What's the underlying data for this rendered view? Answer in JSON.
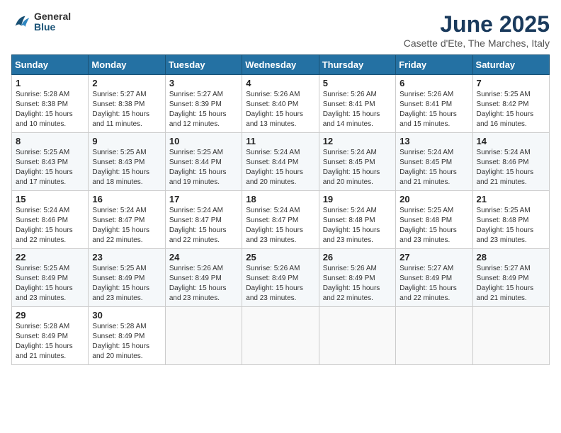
{
  "logo": {
    "general": "General",
    "blue": "Blue"
  },
  "title": "June 2025",
  "subtitle": "Casette d'Ete, The Marches, Italy",
  "days_of_week": [
    "Sunday",
    "Monday",
    "Tuesday",
    "Wednesday",
    "Thursday",
    "Friday",
    "Saturday"
  ],
  "weeks": [
    [
      {
        "day": "1",
        "sunrise": "5:28 AM",
        "sunset": "8:38 PM",
        "daylight": "15 hours and 10 minutes."
      },
      {
        "day": "2",
        "sunrise": "5:27 AM",
        "sunset": "8:38 PM",
        "daylight": "15 hours and 11 minutes."
      },
      {
        "day": "3",
        "sunrise": "5:27 AM",
        "sunset": "8:39 PM",
        "daylight": "15 hours and 12 minutes."
      },
      {
        "day": "4",
        "sunrise": "5:26 AM",
        "sunset": "8:40 PM",
        "daylight": "15 hours and 13 minutes."
      },
      {
        "day": "5",
        "sunrise": "5:26 AM",
        "sunset": "8:41 PM",
        "daylight": "15 hours and 14 minutes."
      },
      {
        "day": "6",
        "sunrise": "5:26 AM",
        "sunset": "8:41 PM",
        "daylight": "15 hours and 15 minutes."
      },
      {
        "day": "7",
        "sunrise": "5:25 AM",
        "sunset": "8:42 PM",
        "daylight": "15 hours and 16 minutes."
      }
    ],
    [
      {
        "day": "8",
        "sunrise": "5:25 AM",
        "sunset": "8:43 PM",
        "daylight": "15 hours and 17 minutes."
      },
      {
        "day": "9",
        "sunrise": "5:25 AM",
        "sunset": "8:43 PM",
        "daylight": "15 hours and 18 minutes."
      },
      {
        "day": "10",
        "sunrise": "5:25 AM",
        "sunset": "8:44 PM",
        "daylight": "15 hours and 19 minutes."
      },
      {
        "day": "11",
        "sunrise": "5:24 AM",
        "sunset": "8:44 PM",
        "daylight": "15 hours and 20 minutes."
      },
      {
        "day": "12",
        "sunrise": "5:24 AM",
        "sunset": "8:45 PM",
        "daylight": "15 hours and 20 minutes."
      },
      {
        "day": "13",
        "sunrise": "5:24 AM",
        "sunset": "8:45 PM",
        "daylight": "15 hours and 21 minutes."
      },
      {
        "day": "14",
        "sunrise": "5:24 AM",
        "sunset": "8:46 PM",
        "daylight": "15 hours and 21 minutes."
      }
    ],
    [
      {
        "day": "15",
        "sunrise": "5:24 AM",
        "sunset": "8:46 PM",
        "daylight": "15 hours and 22 minutes."
      },
      {
        "day": "16",
        "sunrise": "5:24 AM",
        "sunset": "8:47 PM",
        "daylight": "15 hours and 22 minutes."
      },
      {
        "day": "17",
        "sunrise": "5:24 AM",
        "sunset": "8:47 PM",
        "daylight": "15 hours and 22 minutes."
      },
      {
        "day": "18",
        "sunrise": "5:24 AM",
        "sunset": "8:47 PM",
        "daylight": "15 hours and 23 minutes."
      },
      {
        "day": "19",
        "sunrise": "5:24 AM",
        "sunset": "8:48 PM",
        "daylight": "15 hours and 23 minutes."
      },
      {
        "day": "20",
        "sunrise": "5:25 AM",
        "sunset": "8:48 PM",
        "daylight": "15 hours and 23 minutes."
      },
      {
        "day": "21",
        "sunrise": "5:25 AM",
        "sunset": "8:48 PM",
        "daylight": "15 hours and 23 minutes."
      }
    ],
    [
      {
        "day": "22",
        "sunrise": "5:25 AM",
        "sunset": "8:49 PM",
        "daylight": "15 hours and 23 minutes."
      },
      {
        "day": "23",
        "sunrise": "5:25 AM",
        "sunset": "8:49 PM",
        "daylight": "15 hours and 23 minutes."
      },
      {
        "day": "24",
        "sunrise": "5:26 AM",
        "sunset": "8:49 PM",
        "daylight": "15 hours and 23 minutes."
      },
      {
        "day": "25",
        "sunrise": "5:26 AM",
        "sunset": "8:49 PM",
        "daylight": "15 hours and 23 minutes."
      },
      {
        "day": "26",
        "sunrise": "5:26 AM",
        "sunset": "8:49 PM",
        "daylight": "15 hours and 22 minutes."
      },
      {
        "day": "27",
        "sunrise": "5:27 AM",
        "sunset": "8:49 PM",
        "daylight": "15 hours and 22 minutes."
      },
      {
        "day": "28",
        "sunrise": "5:27 AM",
        "sunset": "8:49 PM",
        "daylight": "15 hours and 21 minutes."
      }
    ],
    [
      {
        "day": "29",
        "sunrise": "5:28 AM",
        "sunset": "8:49 PM",
        "daylight": "15 hours and 21 minutes."
      },
      {
        "day": "30",
        "sunrise": "5:28 AM",
        "sunset": "8:49 PM",
        "daylight": "15 hours and 20 minutes."
      },
      null,
      null,
      null,
      null,
      null
    ]
  ]
}
